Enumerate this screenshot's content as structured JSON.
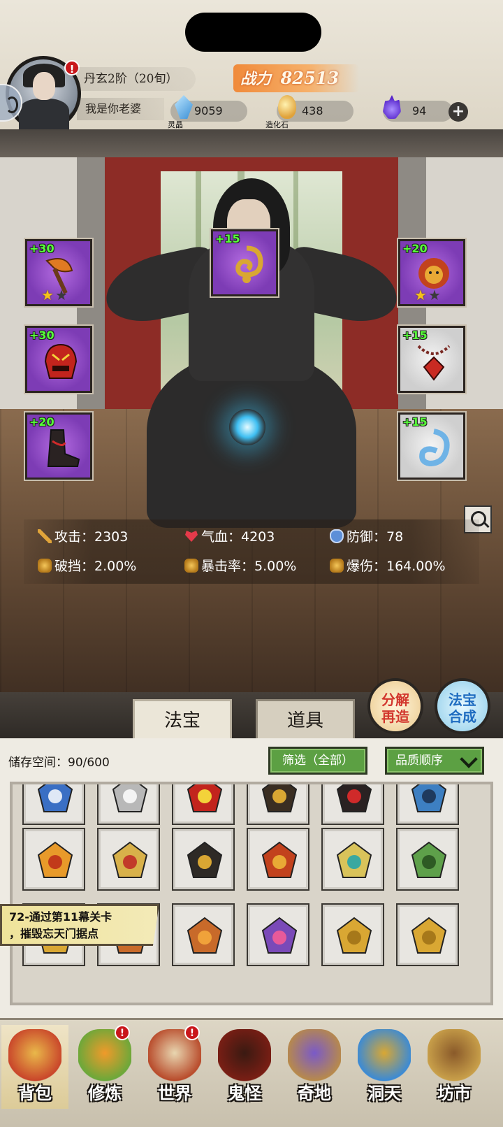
{
  "header": {
    "realm": "丹玄2阶（20旬）",
    "player_name": "我是你老婆",
    "power_label": "战力",
    "power_value": "82513",
    "avatar_alert": "!",
    "resources": [
      {
        "name": "lingjing",
        "label": "灵晶",
        "value": "9059",
        "icon": "crystal-icon"
      },
      {
        "name": "zaohua",
        "label": "造化石",
        "value": "438",
        "icon": "zaohua-stone-icon"
      },
      {
        "name": "hun",
        "label": "",
        "value": "94",
        "icon": "soul-flame-icon"
      }
    ],
    "add_button": "+"
  },
  "equipment": {
    "slots": [
      {
        "level": "+30",
        "stars": [
          "★",
          "★"
        ],
        "stars_filled": 1,
        "rarity": "purple",
        "icon": "axe-weapon-icon"
      },
      {
        "level": "+30",
        "stars": [],
        "rarity": "purple",
        "icon": "demon-helmet-icon"
      },
      {
        "level": "+20",
        "stars": [],
        "rarity": "purple",
        "icon": "boots-icon"
      },
      {
        "level": "+15",
        "stars": [],
        "rarity": "purple",
        "icon": "golden-cloud-token-icon"
      },
      {
        "level": "+20",
        "stars": [
          "★",
          "★"
        ],
        "stars_filled": 1,
        "rarity": "purple",
        "icon": "lion-beast-icon"
      },
      {
        "level": "+15",
        "stars": [],
        "rarity": "white",
        "icon": "pendant-necklace-icon"
      },
      {
        "level": "+15",
        "stars": [],
        "rarity": "white",
        "icon": "jade-ring-icon"
      }
    ]
  },
  "stats": {
    "attack": "攻击：2303",
    "hp": "气血：4203",
    "defense": "防御：78",
    "pierce": "破挡：2.00%",
    "crit_rate": "暴击率：5.00%",
    "crit_damage": "爆伤：164.00%"
  },
  "tabs": {
    "fabao": "法宝",
    "daoju": "道具",
    "active": "法宝"
  },
  "actions": {
    "decompose_top": "分解",
    "decompose_bottom": "再造",
    "synthesize_top": "法宝",
    "synthesize_bottom": "合成"
  },
  "inventory": {
    "storage": "储存空间：90/600",
    "filter": "筛选（全部）",
    "sort": "品质顺序",
    "rows": [
      [
        "blue-robe-icon",
        "white-armor-icon",
        "demon-helmet-icon",
        "dark-robe-icon",
        "red-boots-icon",
        "blue-boots-icon"
      ],
      [
        "flame-gauntlet-icon",
        "feather-shoe-icon",
        "dagger-icon",
        "lion-beast-icon",
        "jade-sword-icon",
        "vine-ring-icon"
      ],
      [
        "gold-pendant-icon",
        "compass-star-icon",
        "compass-star-icon",
        "yinyang-star-icon",
        "golden-cloud-token-icon",
        "golden-cloud-token-icon"
      ]
    ]
  },
  "quest": {
    "line1": "72-通过第11幕关卡",
    "line2": "，摧毁忘天门据点"
  },
  "nav": [
    {
      "label": "背包",
      "icon": "backpack-icon",
      "alert": ""
    },
    {
      "label": "修炼",
      "icon": "cultivate-flower-icon",
      "alert": "!"
    },
    {
      "label": "世界",
      "icon": "world-scroll-icon",
      "alert": "!"
    },
    {
      "label": "鬼怪",
      "icon": "demon-egg-icon",
      "alert": ""
    },
    {
      "label": "奇地",
      "icon": "floating-island-icon",
      "alert": ""
    },
    {
      "label": "洞天",
      "icon": "portal-gate-icon",
      "alert": ""
    },
    {
      "label": "坊市",
      "icon": "market-stall-icon",
      "alert": ""
    }
  ],
  "colors": {
    "purple_rarity": "#8b44c2",
    "level_green": "#57ff3a",
    "filter_green": "#5ca043",
    "alert_red": "#c9171b",
    "power_orange": "#f08a3a"
  }
}
